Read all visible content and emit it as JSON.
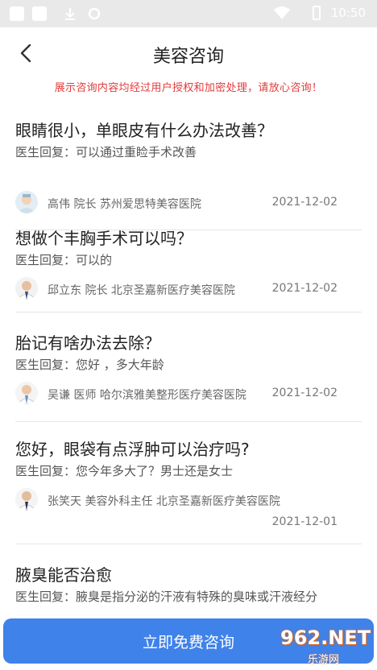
{
  "status_bar": {
    "time": "10:50"
  },
  "header": {
    "title": "美容咨询"
  },
  "notice": "展示咨询内容均经过用户授权和加密处理，请放心咨询！",
  "items": [
    {
      "question": "眼睛很小，单眼皮有什么办法改善？",
      "answer": "医生回复：可以通过重睑手术改善",
      "doctor": "高伟   院长   苏州爱思特美容医院",
      "date": "2021-12-02"
    },
    {
      "question": "想做个丰胸手术可以吗？",
      "answer": "医生回复：可以的",
      "doctor": "邱立东   院长   北京圣嘉新医疗美容医院",
      "date": "2021-12-02"
    },
    {
      "question": "胎记有啥办法去除？",
      "answer": "医生回复：您好 ，多大年龄",
      "doctor": "吴谦   医师   哈尔滨雅美整形医疗美容医院",
      "date": "2021-12-02"
    },
    {
      "question": "您好，眼袋有点浮肿可以治疗吗?",
      "answer": "医生回复：您今年多大了？男士还是女士",
      "doctor": "张笑天   美容外科主任   北京圣嘉新医疗美容医院",
      "date": "2021-12-01"
    },
    {
      "question": "腋臭能否治愈",
      "answer": "医生回复：腋臭是指分泌的汗液有特殊的臭味或汗液经分"
    }
  ],
  "cta": {
    "label": "立即免费咨询"
  },
  "watermark": {
    "text": "962.NET",
    "sub": "乐游网"
  },
  "colors": {
    "accent": "#3f82ea",
    "notice": "#e23b3b"
  }
}
